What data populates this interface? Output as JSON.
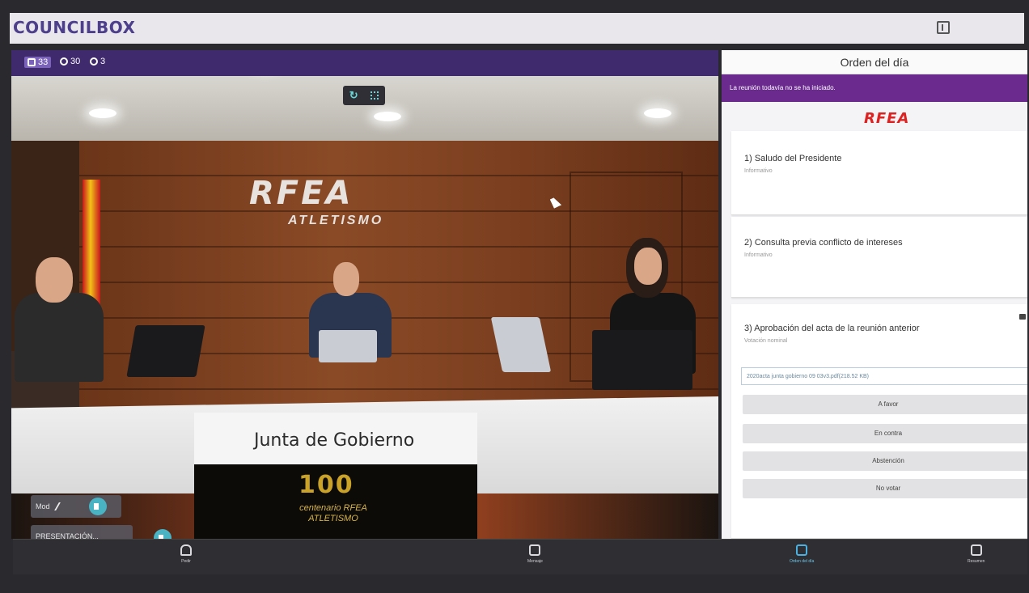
{
  "header": {
    "logo": "COUNCILBOX"
  },
  "video": {
    "stats": {
      "users": "33",
      "online": "30",
      "clock": "3"
    },
    "wall_sign": "RFEA",
    "wall_sign_sub": "ATLETISMO",
    "desk_text": "Junta de Gobierno",
    "banner_main": "100",
    "banner_sub": "centenario RFEA ATLETISMO",
    "participants": [
      {
        "name": "Mod"
      },
      {
        "name": "PRESENTACIÓN..."
      }
    ]
  },
  "bottom_bar": {
    "hand_label": "Pedir",
    "messages_label": "Mensaje",
    "agenda_label": "Orden del día",
    "summary_label": "Resumen"
  },
  "agenda": {
    "title": "Orden del día",
    "status": "La reunión todavía no se ha iniciado.",
    "logo": "RFEA",
    "items": [
      {
        "title": "1) Saludo del Presidente",
        "type": "Informativo"
      },
      {
        "title": "2) Consulta previa conflicto de intereses",
        "type": "Informativo"
      },
      {
        "title": "3) Aprobación del acta de la reunión anterior",
        "type": "Votación nominal"
      }
    ],
    "document": "2020acta junta gobierno 09 03v3.pdf(218.52 KB)",
    "vote_options": [
      "A favor",
      "En contra",
      "Abstención",
      "No votar"
    ]
  }
}
